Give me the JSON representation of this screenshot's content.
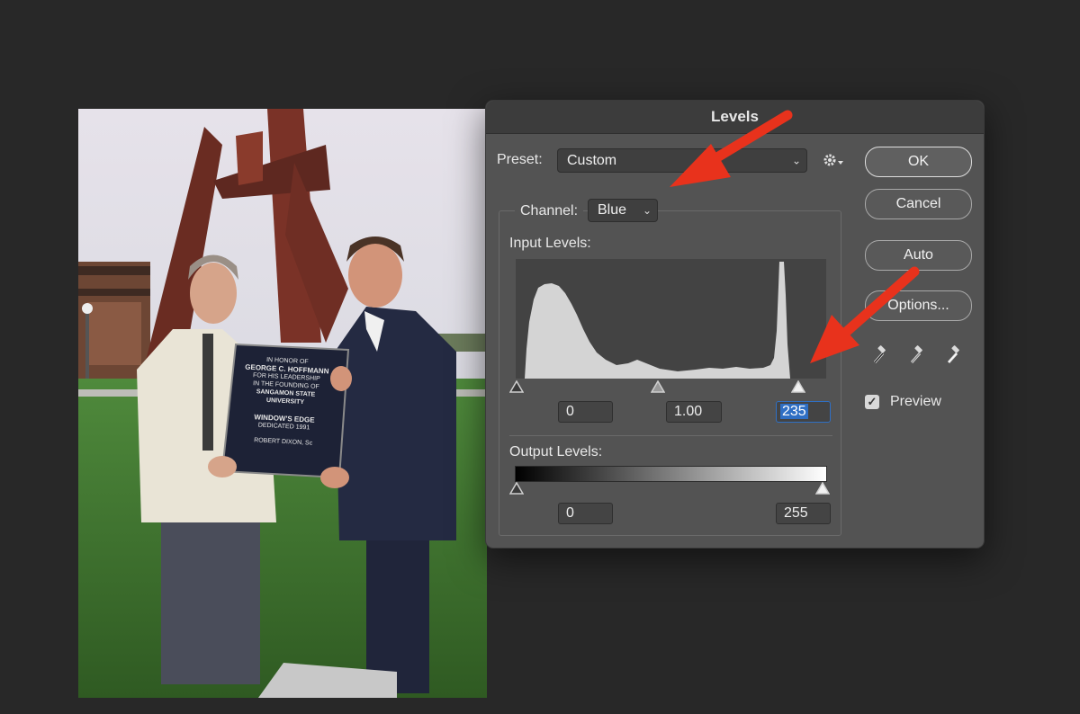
{
  "dialog": {
    "title": "Levels",
    "preset_label": "Preset:",
    "preset_value": "Custom",
    "channel_label": "Channel:",
    "channel_value": "Blue",
    "input_levels_label": "Input Levels:",
    "input_black": "0",
    "input_gamma": "1.00",
    "input_white": "235",
    "output_levels_label": "Output Levels:",
    "output_black": "0",
    "output_white": "255",
    "preview_label": "Preview",
    "preview_checked": true
  },
  "buttons": {
    "ok": "OK",
    "cancel": "Cancel",
    "auto": "Auto",
    "options": "Options..."
  },
  "photo": {
    "plaque_lines": [
      "IN HONOR OF",
      "GEORGE C. HOFFMANN",
      "FOR HIS LEADERSHIP",
      "IN THE FOUNDING OF",
      "SANGAMON STATE",
      "UNIVERSITY",
      "WINDOW'S EDGE",
      "DEDICATED 1991",
      "ROBERT DIXON, Sc"
    ]
  },
  "colors": {
    "annotation_arrow": "#e8321c",
    "dialog_bg": "#535353",
    "selection_blue": "#2f6fc4"
  }
}
